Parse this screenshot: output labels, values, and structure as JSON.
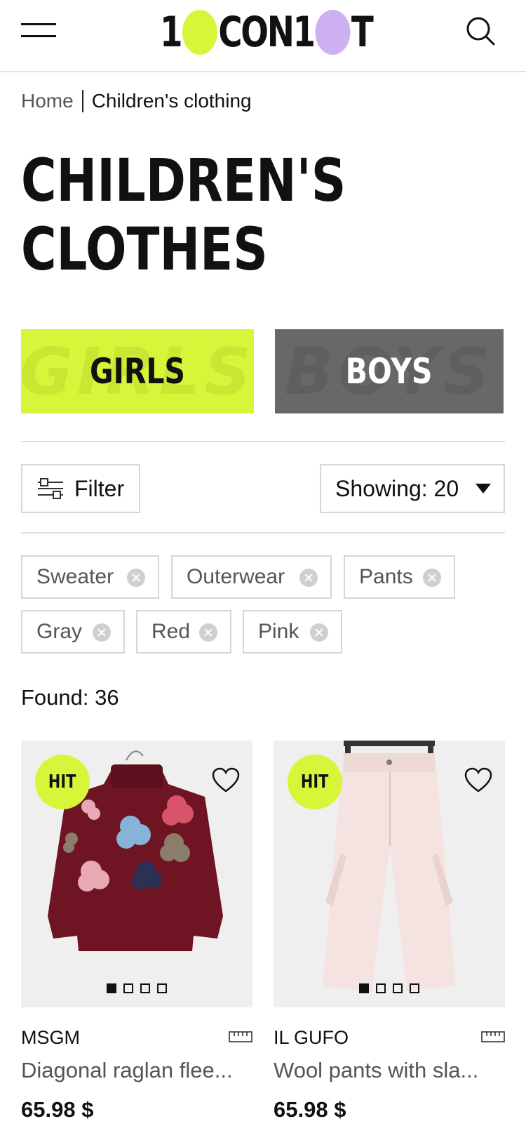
{
  "header": {
    "logo_parts": [
      "1",
      "CON1",
      "T"
    ],
    "logo_dot_colors": [
      "#d8f53a",
      "#cdb0f2"
    ]
  },
  "breadcrumb": {
    "home": "Home",
    "current": "Children's clothing"
  },
  "page_title": "CHILDREN'S CLOTHES",
  "categories": [
    {
      "label": "GIRLS",
      "bg_text": "GIRLS",
      "color": "#d8f53a"
    },
    {
      "label": "BOYS",
      "bg_text": "BOYS",
      "color": "#686868"
    }
  ],
  "toolbar": {
    "filter_label": "Filter",
    "showing_label": "Showing: 20"
  },
  "active_filters": [
    "Sweater",
    "Outerwear",
    "Pants",
    "Gray",
    "Red",
    "Pink"
  ],
  "found_label": "Found: 36",
  "products": [
    {
      "badge": "HIT",
      "brand": "MSGM",
      "name": "Diagonal raglan flee...",
      "price": "65.98 $",
      "image_dots": 4,
      "active_dot": 1
    },
    {
      "badge": "HIT",
      "brand": "IL GUFO",
      "name": "Wool pants with sla...",
      "price": "65.98 $",
      "image_dots": 4,
      "active_dot": 1
    }
  ],
  "colors": {
    "accent_lime": "#d8f53a",
    "accent_lilac": "#cdb0f2",
    "boys_gray": "#686868",
    "text": "#111111",
    "muted": "#555555"
  }
}
